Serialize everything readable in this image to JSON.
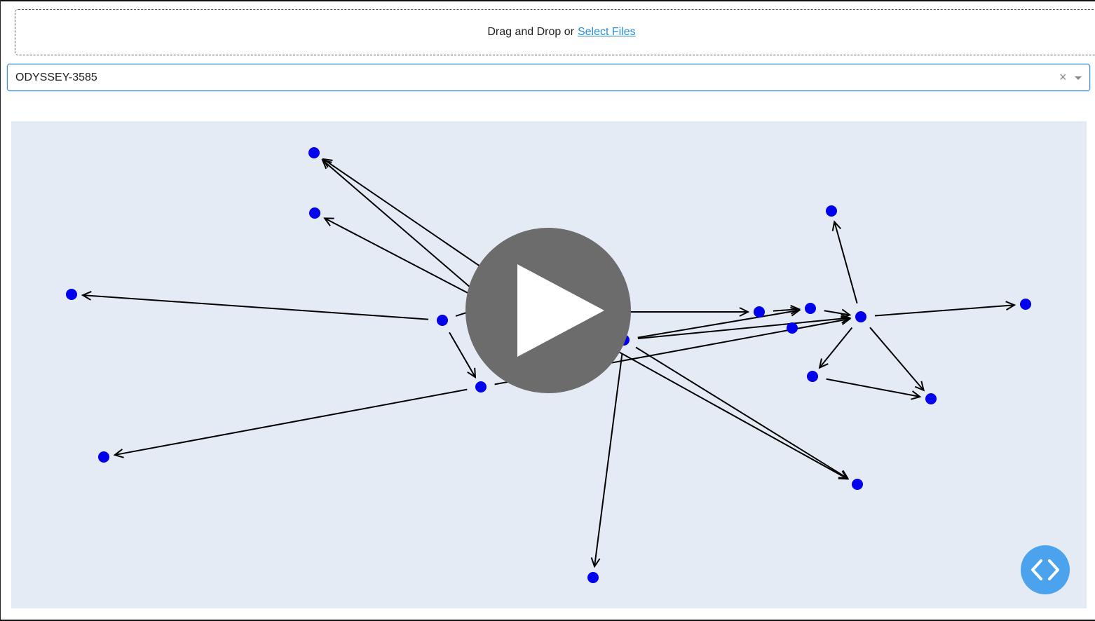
{
  "upload": {
    "prefix_text": "Drag and Drop or ",
    "link_text": "Select Files"
  },
  "dropdown": {
    "selected_value": "ODYSSEY-3585",
    "clear_glyph": "×"
  },
  "graph": {
    "background_color": "#e5ebf5",
    "node_color": "#0000ee",
    "edge_color": "#000000",
    "nodes": [
      {
        "id": "n1"
      },
      {
        "id": "n2"
      },
      {
        "id": "n3"
      },
      {
        "id": "n4"
      },
      {
        "id": "n5"
      },
      {
        "id": "n6"
      },
      {
        "id": "n7"
      },
      {
        "id": "n8"
      },
      {
        "id": "n9"
      },
      {
        "id": "n10"
      },
      {
        "id": "n11"
      },
      {
        "id": "n12"
      },
      {
        "id": "n13"
      },
      {
        "id": "n14"
      },
      {
        "id": "n15"
      },
      {
        "id": "n16"
      },
      {
        "id": "n17"
      },
      {
        "id": "n18"
      },
      {
        "id": "n19"
      }
    ]
  },
  "overlay": {
    "play_icon": "play-icon",
    "code_icon": "code-icon",
    "overlay_color": "#6c6c6c",
    "code_button_color": "#4ba3ee"
  }
}
